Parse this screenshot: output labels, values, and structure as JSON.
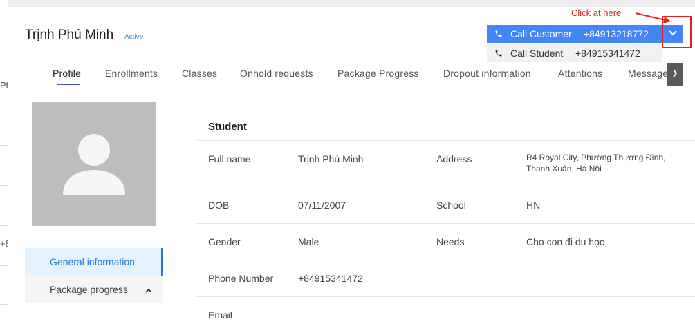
{
  "annotation": {
    "text": "Click at here"
  },
  "background_page": {
    "fragments": [
      "Ph",
      "+8"
    ]
  },
  "header": {
    "student_name": "Trịnh Phú Minh",
    "status": "Active"
  },
  "call": {
    "primary": {
      "label": "Call Customer",
      "number": "+84913218772"
    },
    "secondary": {
      "label": "Call Student",
      "number": "+84915341472"
    }
  },
  "tabs": [
    {
      "label": "Profile"
    },
    {
      "label": "Enrollments"
    },
    {
      "label": "Classes"
    },
    {
      "label": "Onhold requests"
    },
    {
      "label": "Package Progress"
    },
    {
      "label": "Dropout information"
    },
    {
      "label": "Attentions"
    },
    {
      "label": "Messages"
    }
  ],
  "sidebar": {
    "items": [
      {
        "label": "General information"
      },
      {
        "label": "Package progress"
      }
    ]
  },
  "student": {
    "section_title": "Student",
    "fields": {
      "full_name": {
        "label": "Full name",
        "value": "Trịnh Phú Minh"
      },
      "address": {
        "label": "Address",
        "value": "R4 Royal City, Phường Thượng Đình, Thanh Xuân, Hà Nội"
      },
      "dob": {
        "label": "DOB",
        "value": "07/11/2007"
      },
      "school": {
        "label": "School",
        "value": "HN"
      },
      "gender": {
        "label": "Gender",
        "value": "Male"
      },
      "needs": {
        "label": "Needs",
        "value": "Cho con đi du học"
      },
      "phone": {
        "label": "Phone Number",
        "value": "+84915341472"
      },
      "email": {
        "label": "Email",
        "value": ""
      }
    }
  },
  "colors": {
    "accent": "#4285f4",
    "active_tab": "#3f51b5",
    "annotation": "#e02020"
  }
}
